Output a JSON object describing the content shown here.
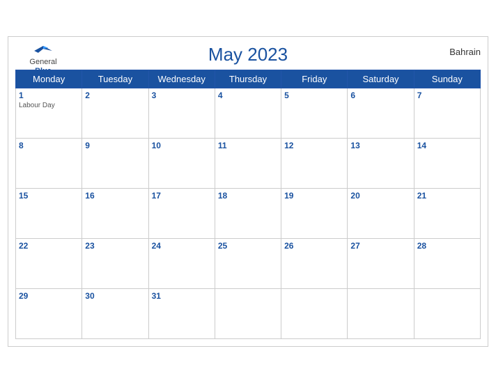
{
  "header": {
    "title": "May 2023",
    "country": "Bahrain",
    "logo": {
      "line1": "General",
      "line2": "Blue"
    }
  },
  "weekdays": [
    "Monday",
    "Tuesday",
    "Wednesday",
    "Thursday",
    "Friday",
    "Saturday",
    "Sunday"
  ],
  "weeks": [
    [
      {
        "day": 1,
        "event": "Labour Day"
      },
      {
        "day": 2
      },
      {
        "day": 3
      },
      {
        "day": 4
      },
      {
        "day": 5
      },
      {
        "day": 6
      },
      {
        "day": 7
      }
    ],
    [
      {
        "day": 8
      },
      {
        "day": 9
      },
      {
        "day": 10
      },
      {
        "day": 11
      },
      {
        "day": 12
      },
      {
        "day": 13
      },
      {
        "day": 14
      }
    ],
    [
      {
        "day": 15
      },
      {
        "day": 16
      },
      {
        "day": 17
      },
      {
        "day": 18
      },
      {
        "day": 19
      },
      {
        "day": 20
      },
      {
        "day": 21
      }
    ],
    [
      {
        "day": 22
      },
      {
        "day": 23
      },
      {
        "day": 24
      },
      {
        "day": 25
      },
      {
        "day": 26
      },
      {
        "day": 27
      },
      {
        "day": 28
      }
    ],
    [
      {
        "day": 29
      },
      {
        "day": 30
      },
      {
        "day": 31
      },
      {
        "day": null
      },
      {
        "day": null
      },
      {
        "day": null
      },
      {
        "day": null
      }
    ]
  ]
}
